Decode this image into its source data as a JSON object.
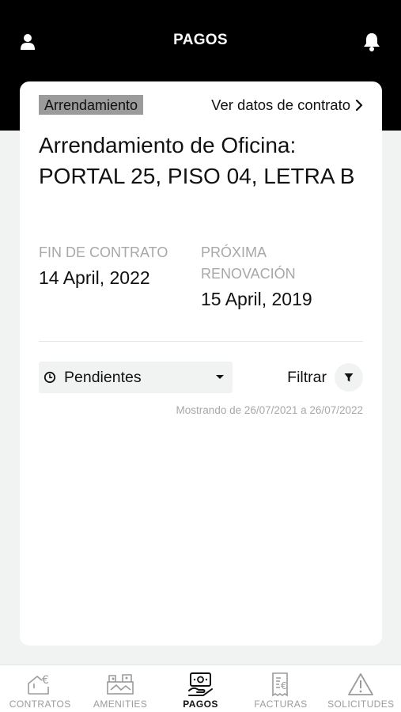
{
  "header": {
    "title": "PAGOS",
    "icons": {
      "left": "user-icon",
      "right": "bell-icon"
    }
  },
  "contract": {
    "tag": "Arrendamiento",
    "view_link": "Ver datos de contrato",
    "title": "Arrendamiento de Oficina: PORTAL 25, PISO 04, LETRA B",
    "end_label": "FIN DE CONTRATO",
    "end_value": "14 April, 2022",
    "renewal_label_line1": "PRÓXIMA",
    "renewal_label_line2": "RENOVACIÓN",
    "renewal_value": "15 April, 2019"
  },
  "filters": {
    "status_selected": "Pendientes",
    "filter_label": "Filtrar",
    "range_text": "Mostrando de 26/07/2021 a 26/07/2022"
  },
  "tabs": [
    {
      "label": "CONTRATOS",
      "icon": "contract-euro-icon",
      "active": false
    },
    {
      "label": "AMENITIES",
      "icon": "amenities-icon",
      "active": false
    },
    {
      "label": "PAGOS",
      "icon": "payments-icon",
      "active": true
    },
    {
      "label": "FACTURAS",
      "icon": "invoice-euro-icon",
      "active": false
    },
    {
      "label": "SOLICITUDES",
      "icon": "warning-icon",
      "active": false
    }
  ],
  "colors": {
    "header_bg": "#000000",
    "page_bg": "#f1f3f3",
    "tag_bg": "#9b9b9b",
    "muted_text": "#a8a8a8",
    "inactive_tab": "#9b9b9b"
  }
}
